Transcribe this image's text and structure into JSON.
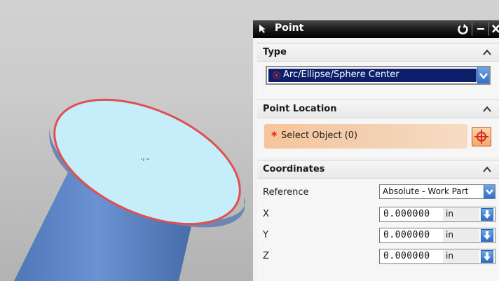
{
  "dialog": {
    "title": "Point",
    "icons": [
      "select-arrow-icon",
      "reset-icon",
      "minimize-icon",
      "close-icon"
    ]
  },
  "type_section": {
    "label": "Type",
    "selected_value": "Arc/Ellipse/Sphere Center"
  },
  "point_location_section": {
    "label": "Point Location",
    "required_marker": "*",
    "select_object_label": "Select Object (0)"
  },
  "coordinates_section": {
    "label": "Coordinates",
    "reference_label": "Reference",
    "reference_value": "Absolute - Work Part",
    "fields": [
      {
        "label": "X",
        "value": "0.000000",
        "unit": "in"
      },
      {
        "label": "Y",
        "value": "0.000000",
        "unit": "in"
      },
      {
        "label": "Z",
        "value": "0.000000",
        "unit": "in"
      }
    ]
  },
  "colors": {
    "disc_top": "#bfeefa",
    "disc_edge": "#e05050",
    "shaft": "#5d87c8",
    "title_bar": "#000000",
    "selection_highlight": "#0c1f6b",
    "select_object_fill": "#f5c9a2"
  }
}
